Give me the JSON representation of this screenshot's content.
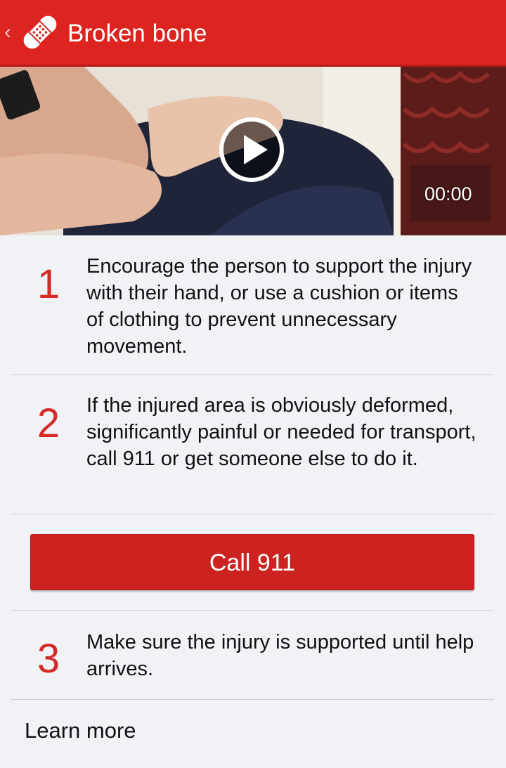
{
  "header": {
    "title": "Broken bone",
    "back_icon": "chevron-left-icon",
    "logo_icon": "bandage-icon",
    "background_color": "#dc2420"
  },
  "video": {
    "time": "00:00",
    "play_icon": "play-icon"
  },
  "steps": [
    {
      "number": "1",
      "text": "Encourage the person to support the injury with their hand, or use a cushion or items of clothing to prevent unnecessary movement."
    },
    {
      "number": "2",
      "text": "If the injured area is obviously deformed, significantly painful or needed for transport, call 911 or get someone else to do it."
    },
    {
      "number": "3",
      "text": "Make sure the injury is supported until help arrives."
    }
  ],
  "call_button": {
    "label": "Call 911",
    "color": "#cc2320"
  },
  "learn_more": {
    "label": "Learn more"
  },
  "accent_color": "#d42b27"
}
